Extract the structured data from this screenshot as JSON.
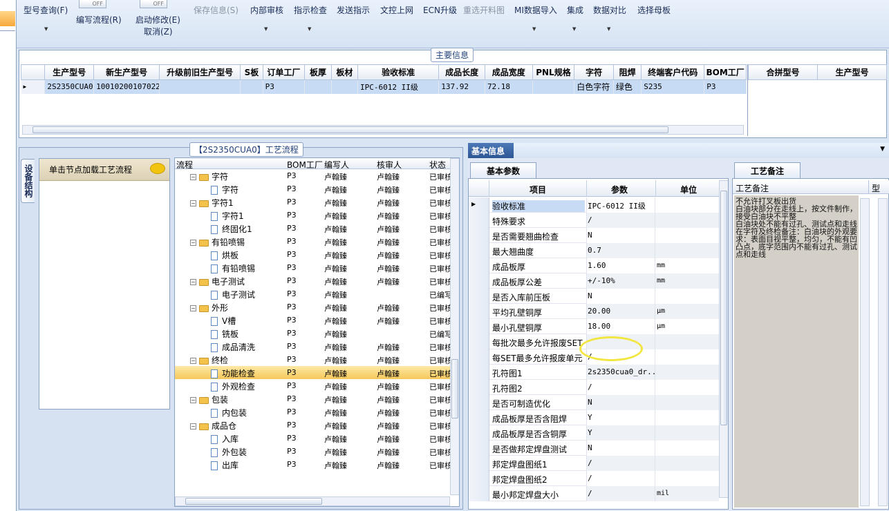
{
  "toolbar": {
    "items": [
      {
        "label": "型号查询(F)",
        "enabled": true,
        "has_dropdown": true
      },
      {
        "label": "编写流程(R)",
        "enabled": true,
        "switch": "OFF"
      },
      {
        "label": "启动修改(E)",
        "sublabel": "取消(Z)",
        "enabled": true,
        "switch": "OFF"
      },
      {
        "label": "保存信息(S)",
        "enabled": false
      },
      {
        "label": "内部审核",
        "enabled": true,
        "has_dropdown": true
      },
      {
        "label": "指示检查",
        "enabled": true,
        "has_dropdown": true
      },
      {
        "label": "发送指示",
        "enabled": true
      },
      {
        "label": "文控上网",
        "enabled": true
      },
      {
        "label": "ECN升级",
        "enabled": true
      },
      {
        "label": "重选开料图",
        "enabled": false
      },
      {
        "label": "MI数据导入",
        "enabled": true,
        "has_dropdown": true
      },
      {
        "label": "集成",
        "enabled": true,
        "has_dropdown": true
      },
      {
        "label": "数据对比",
        "enabled": true,
        "has_dropdown": true
      },
      {
        "label": "选择母板",
        "enabled": true
      }
    ]
  },
  "main_info": {
    "caption": "主要信息",
    "columns": [
      "生产型号",
      "新生产型号",
      "升级前旧生产型号",
      "S板",
      "订单工厂",
      "板厚",
      "板材",
      "验收标准",
      "成品长度",
      "成品宽度",
      "PNL规格",
      "字符",
      "阻焊",
      "终端客户代码",
      "BOM工厂"
    ],
    "rows": [
      [
        "2S2350CUA0",
        "10010200107022",
        "",
        "",
        "P3",
        "",
        "",
        "IPC-6012 II级",
        "137.92",
        "72.18",
        "",
        "白色字符",
        "绿色",
        "S235",
        "P3"
      ]
    ],
    "side_columns": [
      "合拼型号",
      "生产型号"
    ]
  },
  "process": {
    "caption": "【2S2350CUA0】工艺流程",
    "side_tab": "设备结构",
    "hint": "单击节点加载工艺流程",
    "columns": [
      "流程",
      "BOM工厂",
      "编写人",
      "核审人",
      "状态"
    ],
    "rows": [
      {
        "level": 0,
        "name": "字符",
        "bom": "P3",
        "writer": "卢翰臻",
        "checker": "卢翰臻",
        "status": "已审核"
      },
      {
        "level": 1,
        "name": "字符",
        "bom": "P3",
        "writer": "卢翰臻",
        "checker": "卢翰臻",
        "status": "已审核"
      },
      {
        "level": 0,
        "name": "字符1",
        "bom": "P3",
        "writer": "卢翰臻",
        "checker": "卢翰臻",
        "status": "已审核"
      },
      {
        "level": 1,
        "name": "字符1",
        "bom": "P3",
        "writer": "卢翰臻",
        "checker": "卢翰臻",
        "status": "已审核"
      },
      {
        "level": 1,
        "name": "终固化1",
        "bom": "P3",
        "writer": "卢翰臻",
        "checker": "卢翰臻",
        "status": "已审核"
      },
      {
        "level": 0,
        "name": "有铅喷锡",
        "bom": "P3",
        "writer": "卢翰臻",
        "checker": "卢翰臻",
        "status": "已审核"
      },
      {
        "level": 1,
        "name": "烘板",
        "bom": "P3",
        "writer": "卢翰臻",
        "checker": "卢翰臻",
        "status": "已审核"
      },
      {
        "level": 1,
        "name": "有铅喷锡",
        "bom": "P3",
        "writer": "卢翰臻",
        "checker": "卢翰臻",
        "status": "已审核"
      },
      {
        "level": 0,
        "name": "电子测试",
        "bom": "P3",
        "writer": "卢翰臻",
        "checker": "卢翰臻",
        "status": "已审核"
      },
      {
        "level": 1,
        "name": "电子测试",
        "bom": "P3",
        "writer": "卢翰臻",
        "checker": "",
        "status": "已编写"
      },
      {
        "level": 0,
        "name": "外形",
        "bom": "P3",
        "writer": "卢翰臻",
        "checker": "卢翰臻",
        "status": "已审核"
      },
      {
        "level": 1,
        "name": "V槽",
        "bom": "P3",
        "writer": "卢翰臻",
        "checker": "卢翰臻",
        "status": "已审核"
      },
      {
        "level": 1,
        "name": "铣板",
        "bom": "P3",
        "writer": "卢翰臻",
        "checker": "",
        "status": "已编写"
      },
      {
        "level": 1,
        "name": "成品清洗",
        "bom": "P3",
        "writer": "卢翰臻",
        "checker": "卢翰臻",
        "status": "已审核"
      },
      {
        "level": 0,
        "name": "终检",
        "bom": "P3",
        "writer": "卢翰臻",
        "checker": "卢翰臻",
        "status": "已审核"
      },
      {
        "level": 1,
        "name": "功能检查",
        "bom": "P3",
        "writer": "卢翰臻",
        "checker": "卢翰臻",
        "status": "已审核",
        "selected": true
      },
      {
        "level": 1,
        "name": "外观检查",
        "bom": "P3",
        "writer": "卢翰臻",
        "checker": "卢翰臻",
        "status": "已审核"
      },
      {
        "level": 0,
        "name": "包装",
        "bom": "P3",
        "writer": "卢翰臻",
        "checker": "卢翰臻",
        "status": "已审核"
      },
      {
        "level": 1,
        "name": "内包装",
        "bom": "P3",
        "writer": "卢翰臻",
        "checker": "卢翰臻",
        "status": "已审核"
      },
      {
        "level": 0,
        "name": "成品仓",
        "bom": "P3",
        "writer": "卢翰臻",
        "checker": "卢翰臻",
        "status": "已审核"
      },
      {
        "level": 1,
        "name": "入库",
        "bom": "P3",
        "writer": "卢翰臻",
        "checker": "卢翰臻",
        "status": "已审核"
      },
      {
        "level": 1,
        "name": "外包装",
        "bom": "P3",
        "writer": "卢翰臻",
        "checker": "卢翰臻",
        "status": "已审核"
      },
      {
        "level": 1,
        "name": "出库",
        "bom": "P3",
        "writer": "卢翰臻",
        "checker": "卢翰臻",
        "status": "已审核"
      }
    ]
  },
  "basic_info": {
    "tab": "基本信息",
    "subtab": "基本参数",
    "columns": [
      "项目",
      "参数",
      "单位"
    ],
    "rows": [
      {
        "name": "验收标准",
        "value": "IPC-6012 II级",
        "unit": ""
      },
      {
        "name": "特殊要求",
        "value": "/",
        "unit": ""
      },
      {
        "name": "是否需要翘曲检查",
        "value": "N",
        "unit": ""
      },
      {
        "name": "最大翘曲度",
        "value": "0.7",
        "unit": ""
      },
      {
        "name": "成品板厚",
        "value": "1.60",
        "unit": "mm"
      },
      {
        "name": "成品板厚公差",
        "value": "+/-10%",
        "unit": "mm"
      },
      {
        "name": "是否入库前压板",
        "value": "N",
        "unit": ""
      },
      {
        "name": "平均孔壁铜厚",
        "value": "20.00",
        "unit": "μm"
      },
      {
        "name": "最小孔壁铜厚",
        "value": "18.00",
        "unit": "μm"
      },
      {
        "name": "每批次最多允许报废SET",
        "value": "",
        "unit": ""
      },
      {
        "name": "每SET最多允许报废单元",
        "value": "/",
        "unit": ""
      },
      {
        "name": "孔符图1",
        "value": "2s2350cua0_dr...",
        "unit": ""
      },
      {
        "name": "孔符图2",
        "value": "/",
        "unit": ""
      },
      {
        "name": "是否可制造优化",
        "value": "N",
        "unit": ""
      },
      {
        "name": "成品板厚是否含阻焊",
        "value": "Y",
        "unit": ""
      },
      {
        "name": "成品板厚是否含铜厚",
        "value": "Y",
        "unit": ""
      },
      {
        "name": "是否做邦定焊盘测试",
        "value": "N",
        "unit": ""
      },
      {
        "name": "邦定焊盘图纸1",
        "value": "/",
        "unit": ""
      },
      {
        "name": "邦定焊盘图纸2",
        "value": "/",
        "unit": ""
      },
      {
        "name": "最小邦定焊盘大小",
        "value": "/",
        "unit": "mil"
      }
    ]
  },
  "process_notes": {
    "tab": "工艺备注",
    "header": "工艺备注",
    "side_header": "型",
    "lines": [
      "不允许打叉板出货",
      "白油块部分在走线上，按文件制作，接受白油块不平整",
      "白油块处不能有过孔、测试点和走线",
      "在字符及终检备注：白油块的外观要求：表面目视平整，均匀，不能有凹凸点，底字范围内不能有过孔、测试点和走线"
    ]
  }
}
